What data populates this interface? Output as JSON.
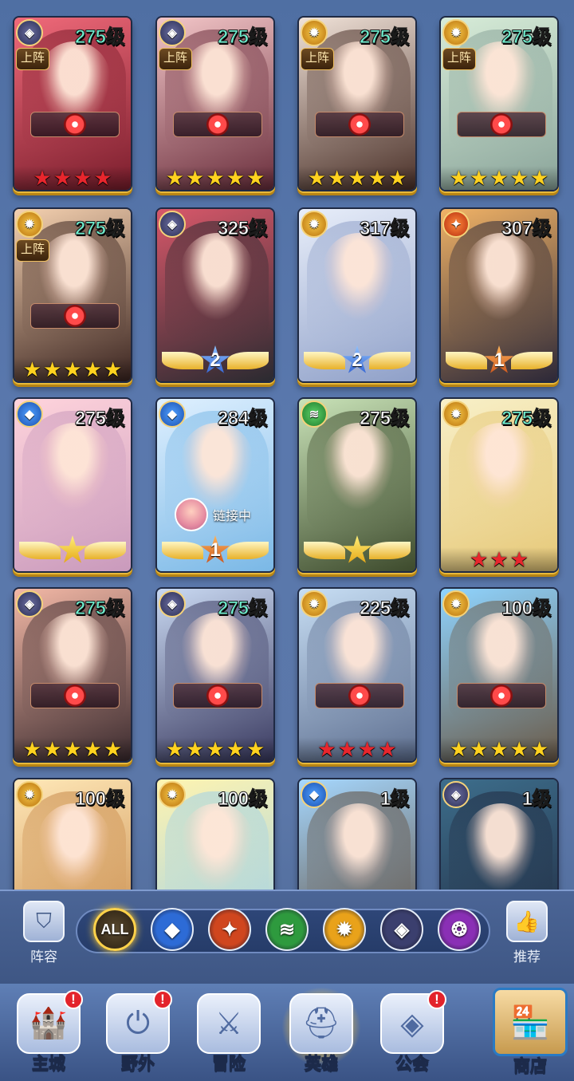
{
  "heroes": [
    {
      "level": "275级",
      "level_color": "teal",
      "faction": "void",
      "on_team": "上阵",
      "bg": [
        "#f06a7a",
        "#7a1d2c"
      ],
      "stars": [
        "red",
        "red",
        "red",
        "red"
      ]
    },
    {
      "level": "275级",
      "level_color": "teal",
      "faction": "void",
      "on_team": "上阵",
      "bg": [
        "#f3c6c8",
        "#6a2e3c"
      ],
      "stars": [
        "gold",
        "gold",
        "gold",
        "gold",
        "gold"
      ]
    },
    {
      "level": "275级",
      "level_color": "teal",
      "faction": "light",
      "on_team": "上阵",
      "bg": [
        "#f0e2d8",
        "#4a3028"
      ],
      "stars": [
        "gold",
        "gold",
        "gold",
        "gold",
        "gold"
      ]
    },
    {
      "level": "275级",
      "level_color": "teal",
      "faction": "light",
      "on_team": "上阵",
      "bg": [
        "#d7ecd8",
        "#8aa49a"
      ],
      "stars": [
        "gold",
        "gold",
        "gold",
        "gold",
        "gold"
      ]
    },
    {
      "level": "275级",
      "level_color": "teal",
      "faction": "light",
      "on_team": "上阵",
      "bg": [
        "#f5d1b0",
        "#3a2420"
      ],
      "stars": [
        "gold",
        "gold",
        "gold",
        "gold",
        "gold"
      ]
    },
    {
      "level": "325级",
      "level_color": "white",
      "faction": "void",
      "bg": [
        "#d8586a",
        "#2a2a30"
      ],
      "rank": {
        "value": "2",
        "type": "blue"
      }
    },
    {
      "level": "317级",
      "level_color": "white",
      "faction": "light",
      "bg": [
        "#e8eefa",
        "#8fa0c8"
      ],
      "rank": {
        "value": "2",
        "type": "blue"
      }
    },
    {
      "level": "307级",
      "level_color": "white",
      "faction": "fire",
      "bg": [
        "#f0b266",
        "#2c2838"
      ],
      "rank": {
        "value": "1",
        "type": "orange"
      }
    },
    {
      "level": "275级",
      "level_color": "white",
      "faction": "water",
      "bg": [
        "#ffd4dc",
        "#c99abc"
      ],
      "rank": {
        "value": "",
        "type": "gold"
      }
    },
    {
      "level": "284级",
      "level_color": "white",
      "faction": "water",
      "bg": [
        "#dff0ff",
        "#7ab8e6"
      ],
      "rank": {
        "value": "1",
        "type": "orange"
      },
      "link_text": "链接中"
    },
    {
      "level": "275级",
      "level_color": "white",
      "faction": "wind",
      "bg": [
        "#c9e3b8",
        "#3d4a2c"
      ],
      "rank": {
        "value": "",
        "type": "gold"
      }
    },
    {
      "level": "275级",
      "level_color": "teal",
      "faction": "light",
      "bg": [
        "#f8f0c8",
        "#e6c878"
      ],
      "stars": [
        "red",
        "red",
        "red"
      ]
    },
    {
      "level": "275级",
      "level_color": "teal",
      "faction": "void",
      "bg": [
        "#f3b8a6",
        "#3a2a2e"
      ],
      "stars": [
        "gold",
        "gold",
        "gold",
        "gold",
        "gold"
      ]
    },
    {
      "level": "275级",
      "level_color": "teal",
      "faction": "void",
      "bg": [
        "#c9d9f2",
        "#3a3a60"
      ],
      "stars": [
        "gold",
        "gold",
        "gold",
        "gold",
        "gold"
      ]
    },
    {
      "level": "225级",
      "level_color": "white",
      "faction": "light",
      "bg": [
        "#c7def4",
        "#5e6f90"
      ],
      "stars": [
        "red",
        "red",
        "red",
        "red"
      ]
    },
    {
      "level": "100级",
      "level_color": "white",
      "faction": "light",
      "bg": [
        "#8fd4ff",
        "#6a5a48"
      ],
      "stars": [
        "gold",
        "gold",
        "gold",
        "gold",
        "gold"
      ]
    },
    {
      "level": "100级",
      "level_color": "white",
      "faction": "light",
      "bg": [
        "#ffe8b8",
        "#c7894a"
      ]
    },
    {
      "level": "100级",
      "level_color": "white",
      "faction": "light",
      "bg": [
        "#fff4b0",
        "#9fd0e8"
      ]
    },
    {
      "level": "1级",
      "level_color": "white",
      "faction": "water",
      "bg": [
        "#a6d8ff",
        "#5d4a3a"
      ]
    },
    {
      "level": "1级",
      "level_color": "white",
      "faction": "void",
      "bg": [
        "#3d6e8c",
        "#202a40"
      ]
    }
  ],
  "filters": {
    "left_label": "阵容",
    "right_label": "推荐",
    "all_label": "ALL",
    "factions": [
      {
        "name": "water",
        "color": "#2d6bd6",
        "glyph": "◆"
      },
      {
        "name": "fire",
        "color": "#d0461e",
        "glyph": "✦"
      },
      {
        "name": "wind",
        "color": "#2e9a3e",
        "glyph": "≋"
      },
      {
        "name": "light",
        "color": "#e9a21a",
        "glyph": "✹"
      },
      {
        "name": "void",
        "color": "#3b3f6e",
        "glyph": "◈"
      },
      {
        "name": "shadow",
        "color": "#8a2fb5",
        "glyph": "❂"
      }
    ]
  },
  "nav": [
    {
      "label": "主城",
      "icon": "castle-icon",
      "badge": "!"
    },
    {
      "label": "野外",
      "icon": "portal-icon",
      "badge": "!"
    },
    {
      "label": "冒险",
      "icon": "sword-icon"
    },
    {
      "label": "英雄",
      "icon": "helmet-icon",
      "active": true
    },
    {
      "label": "公会",
      "icon": "banner-icon",
      "badge": "!"
    },
    {
      "label": "商店",
      "icon": "shop-icon"
    }
  ]
}
